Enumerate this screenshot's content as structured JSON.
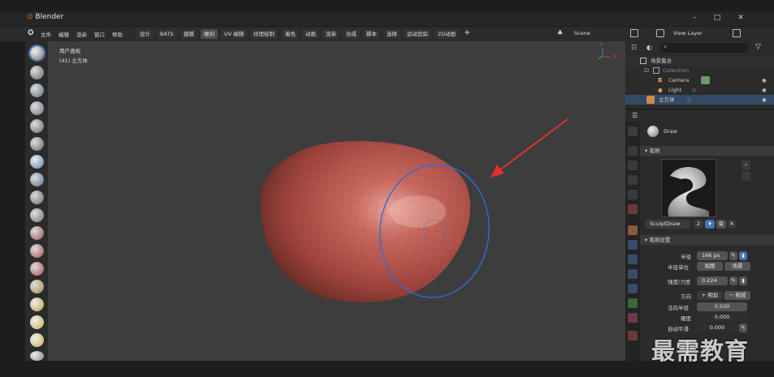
{
  "window": {
    "app_name": "Blender",
    "min_icon": "–",
    "max_icon": "□",
    "close_icon": "✕"
  },
  "menus": [
    "文件",
    "编辑",
    "渲染",
    "窗口",
    "帮助"
  ],
  "workspaces": [
    "设计",
    "BATS",
    "建模",
    "雕刻",
    "UV 编辑",
    "纹理绘制",
    "着色",
    "动画",
    "渲染",
    "合成",
    "脚本",
    "选择",
    "运动追踪",
    "2D动画"
  ],
  "add_workspace": "+",
  "scene": {
    "label": "Scene"
  },
  "view_layer": {
    "label": "View Layer"
  },
  "viewport": {
    "mode_text": "用户透视",
    "object_text": "(41) 立方体",
    "gizmo": {
      "z": "z",
      "x": "x"
    }
  },
  "outliner": {
    "search_placeholder": "",
    "scene_collection": "场景集合",
    "collection": "Collection",
    "camera": "Camera",
    "light": "Light",
    "cube": "立方体"
  },
  "properties": {
    "tool_name": "Draw",
    "brush_section": "笔刷",
    "brush_name": "SculptDraw",
    "brush_count": "2",
    "brush_settings_section": "笔刷设置",
    "radius_label": "半径",
    "radius_value": "166 px",
    "radius_unit_label": "半径单位",
    "radius_unit_view": "视图",
    "radius_unit_scene": "场景",
    "strength_label": "强度/力度",
    "strength_value": "0.224",
    "direction_label": "方向",
    "direction_add": "+ 相加",
    "direction_sub": "− 相减",
    "normal_radius_label": "法向半径",
    "normal_radius_value": "0.500",
    "hardness_label": "硬度",
    "hardness_value": "0.000",
    "autosmooth_label": "自动平滑",
    "autosmooth_value": "0.000"
  },
  "watermark": "最需教育",
  "colors": {
    "accent_blue": "#4772b3",
    "brush_circle": "#2f6bd8",
    "arrow": "#e03030",
    "mesh": "#b5524a"
  }
}
